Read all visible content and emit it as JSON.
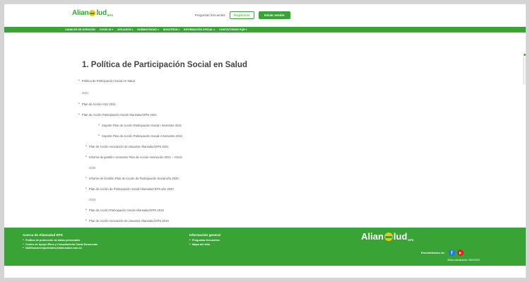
{
  "header": {
    "logo_left": "Alian",
    "logo_right": "lud",
    "logo_suffix": "EPS",
    "faq_link": "Preguntas frecuentes",
    "register_button": "Registrarse",
    "login_button": "Iniciar sesión"
  },
  "nav": {
    "items": [
      "CANALES DE ATENCIÓN",
      "COVID-19 ▾",
      "AFILIADOS ▾",
      "NORMATIVIDAD ▾",
      "NOSOTROS ▾",
      "INFORMACIÓN OFICIAL ▾",
      "CONTÁCTENOS PQR ▾"
    ]
  },
  "content": {
    "title": "1. Política de Participación Social en Salud",
    "list": [
      {
        "text": "Política de Participación Social en Salud",
        "kind": "bullet",
        "indent": 0,
        "gap": 0
      },
      {
        "text": "2021",
        "kind": "year",
        "indent": 0,
        "gap": 12
      },
      {
        "text": "Plan de Acción ASU 2021",
        "kind": "bullet",
        "indent": 0,
        "gap": 11
      },
      {
        "text": "Plan de Acción Participación Social Aliansalud EPS 2021",
        "kind": "bullet",
        "indent": 0,
        "gap": 10
      },
      {
        "text": "Soporte Plan de Acción Participación Social I Semestre 2021",
        "kind": "bullet",
        "indent": 28,
        "gap": 10
      },
      {
        "text": "Soporte Plan de Acción Participación Social II Semestre 2021",
        "kind": "bullet",
        "indent": 28,
        "gap": 10
      },
      {
        "text": "Plan de Acción Asociación de Usuarios Aliansalud EPS 2021",
        "kind": "bullet",
        "indent": 10,
        "gap": 10
      },
      {
        "text": "Informe de gestión I semestre Plan de Acción Asociación 2021 – ASUS",
        "kind": "bullet",
        "indent": 10,
        "gap": 10
      },
      {
        "text": "2020",
        "kind": "year",
        "indent": 10,
        "gap": 10
      },
      {
        "text": "Informe de Gestión Plan de Acción de Participación Social año 2020",
        "kind": "bullet",
        "indent": 10,
        "gap": 10
      },
      {
        "text": "Plan de Acción de Participación Social Aliansalud EPS año 2020",
        "kind": "bullet",
        "indent": 10,
        "gap": 10
      },
      {
        "text": "2019",
        "kind": "year",
        "indent": 10,
        "gap": 10
      },
      {
        "text": "Plan de Acción Participación Social Aliansalud EPS 2019",
        "kind": "bullet",
        "indent": 10,
        "gap": 10
      },
      {
        "text": "Plan de Acción Asociación de Usuarios Aliansalud EPS 2019",
        "kind": "bullet",
        "indent": 10,
        "gap": 10
      }
    ]
  },
  "footer": {
    "col1_title": "Acerca de Aliansalud EPS",
    "col1_links": [
      "Política de protección de datos personales",
      "Centro de Apoyo Ético y Cumplimiento Canal Denuncias",
      "Notificacionesjudiciales@aliansalud.com.co"
    ],
    "col2_title": "Información general",
    "col2_links": [
      "Preguntas frecuentes",
      "Mapa del sitio"
    ],
    "social_label": "Encuéntranos en:",
    "updated": "Última actualización: 06/04/2022"
  },
  "colors": {
    "brand_green": "#3aa335",
    "sun_yellow": "#f5c21b",
    "facebook": "#1877f2",
    "youtube": "#e62117"
  },
  "icons": {
    "social": [
      "facebook-icon",
      "youtube-icon"
    ]
  }
}
